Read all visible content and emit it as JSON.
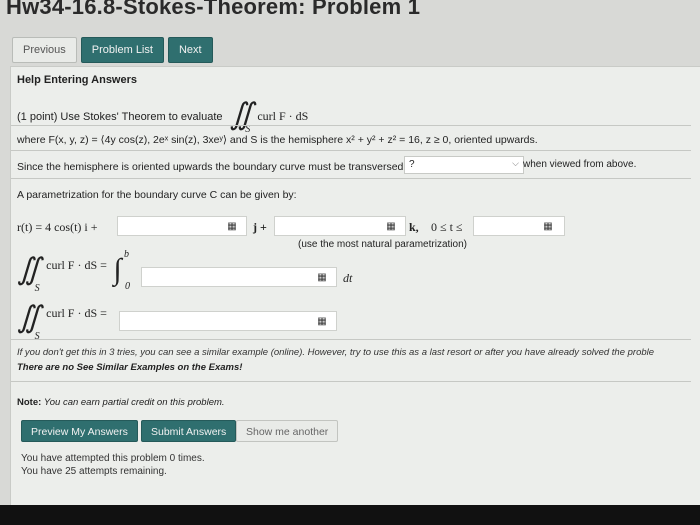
{
  "page": {
    "title": "Hw34-16.8-Stokes-Theorem: Problem 1"
  },
  "nav": {
    "previous": "Previous",
    "problem_list": "Problem List",
    "next": "Next"
  },
  "problem": {
    "help_label": "Help Entering Answers",
    "intro": "(1 point) Use Stokes' Theorem to evaluate",
    "integrand": "curl F · dS",
    "surface_sub": "S",
    "where": "where F(x, y, z) = ⟨4y cos(z), 2eˣ sin(z), 3xeʸ⟩ and S is the hemisphere x² + y² + z² = 16, z ≥ 0, oriented upwards.",
    "since": "Since the hemisphere is oriented upwards the boundary curve must be transversed",
    "select_value": "?",
    "when_viewed": "when viewed from above.",
    "param_intro": "A parametrization for the boundary curve C can be given by:",
    "r_label": "r(t) = 4 cos(t) i +",
    "j_label": "j +",
    "k_label": "k,",
    "t_range_start": "0 ≤ t ≤",
    "natural_note": "(use the most natural parametrization)",
    "line_integral_label": "curl F · dS =",
    "upper_limit": "b",
    "lower_limit": "0",
    "dt_label": "dt",
    "final_label": "curl F · dS ="
  },
  "notes": {
    "tries": "If you don't get this in 3 tries, you can see a similar example (online). However, try to use this as a last resort or after you have already solved the proble",
    "no_similar": "There are no See Similar Examples on the Exams!",
    "partial_label": "Note:",
    "partial": "You can earn partial credit on this problem."
  },
  "buttons": {
    "preview": "Preview My Answers",
    "submit": "Submit Answers",
    "show_another": "Show me another"
  },
  "attempts": {
    "attempted": "You have attempted this problem 0 times.",
    "remaining": "You have 25 attempts remaining."
  },
  "icons": {
    "grid": "grid-icon",
    "chevron": "chevron-down-icon"
  },
  "colors": {
    "accent": "#2f6f6f",
    "panel": "#eceeeb"
  }
}
